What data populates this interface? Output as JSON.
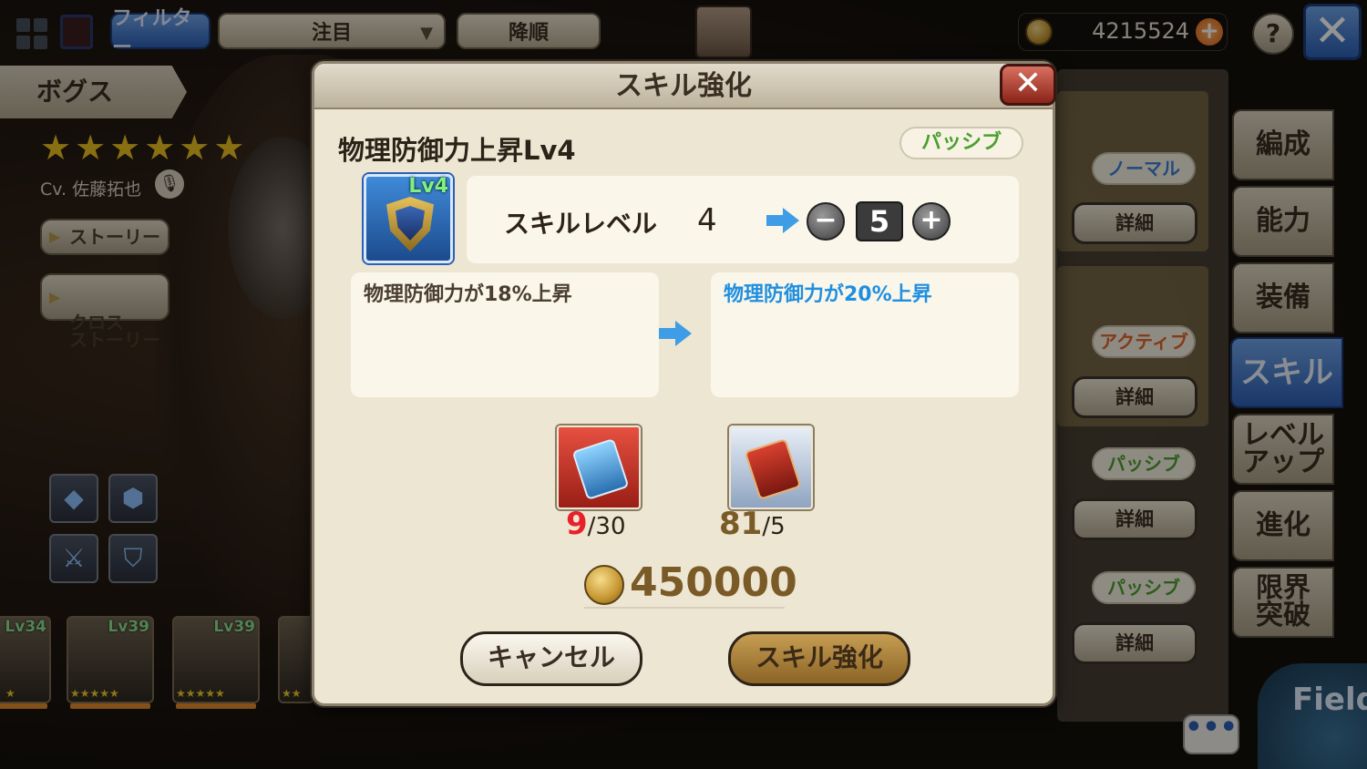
{
  "topbar": {
    "filter_label": "フィルター",
    "sort_key": "注目",
    "sort_order": "降順",
    "currency": "4215524",
    "help_label": "?"
  },
  "character": {
    "name": "ボグス",
    "stars": "★★★★★★",
    "cv": "Cv. 佐藤拓也",
    "story_button": "ストーリー",
    "cross_story_button": "クロス\nストーリー"
  },
  "party_thumbs": [
    {
      "level": "Lv34",
      "stars": "★"
    },
    {
      "level": "Lv39",
      "stars": "★★★★★"
    },
    {
      "level": "Lv39",
      "stars": "★★★★★"
    },
    {
      "level": "",
      "stars": "★★"
    }
  ],
  "skill_list": [
    {
      "type": "ノーマル",
      "type_color": "#3b7fd6",
      "detail": "詳細"
    },
    {
      "type": "アクティブ",
      "type_color": "#e0642a",
      "detail": "詳細"
    },
    {
      "type": "パッシブ",
      "type_color": "#4aa02e",
      "detail": "詳細"
    },
    {
      "type": "パッシブ",
      "type_color": "#4aa02e",
      "detail": "詳細"
    }
  ],
  "side_tabs": [
    "編成",
    "能力",
    "装備",
    "スキル",
    "レベル\nアップ",
    "進化",
    "限界\n突破"
  ],
  "active_tab": "スキル",
  "field_label": "Field",
  "chat_label": "•••",
  "modal": {
    "title": "スキル強化",
    "skill_name": "物理防御力上昇Lv4",
    "skill_type": "パッシブ",
    "icon_level": "Lv4",
    "level_label": "スキルレベル",
    "current_level": "4",
    "new_level": "5",
    "minus": "−",
    "plus": "+",
    "desc_before": "物理防御力が18%上昇",
    "desc_after": "物理防御力が20%上昇",
    "desc_after_color": "#1f8fe0",
    "materials": [
      {
        "have": "9",
        "need": "/30",
        "have_color": "#e8202a"
      },
      {
        "have": "81",
        "need": "/5",
        "have_color": "#7a5a26"
      }
    ],
    "cost": "450000",
    "cancel_label": "キャンセル",
    "confirm_label": "スキル強化"
  }
}
